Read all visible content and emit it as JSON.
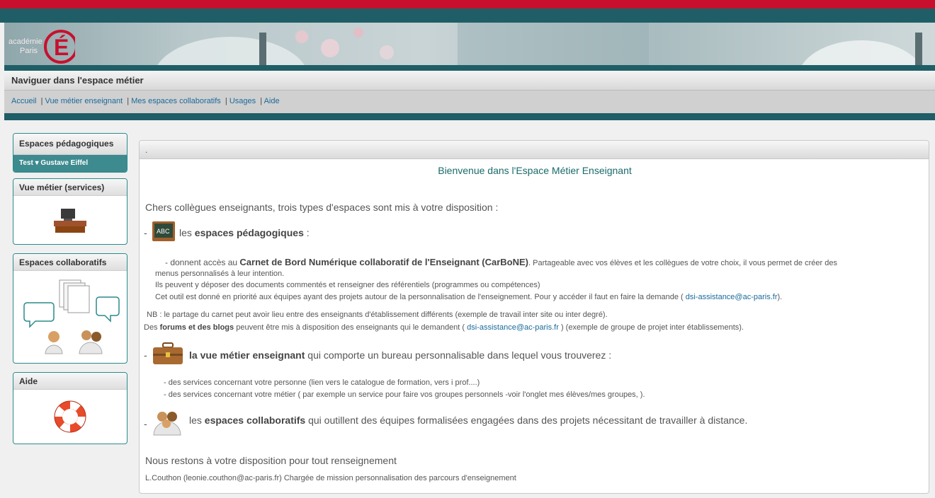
{
  "header": {
    "logo_line1": "académie",
    "logo_line2": "Paris",
    "logo_letter": "É"
  },
  "nav": {
    "title": "Naviguer dans l'espace métier",
    "links": [
      "Accueil",
      "Vue métier enseignant",
      "Mes espaces collaboratifs",
      "Usages",
      "Aide"
    ]
  },
  "sidebar": {
    "pedagogiques": {
      "title": "Espaces pédagogiques",
      "selector": "Test",
      "school": "Gustave Eiffel"
    },
    "vue_metier": {
      "title": "Vue métier (services)"
    },
    "collaboratifs": {
      "title": "Espaces collaboratifs"
    },
    "aide": {
      "title": "Aide"
    }
  },
  "main": {
    "header_text": ".",
    "welcome": "Bienvenue dans l'Espace Métier Enseignant",
    "intro": "Chers collègues enseignants, trois types d'espaces sont mis à votre disposition :",
    "sec1": {
      "dash": "-",
      "icon_text": "ABC",
      "pre": "les ",
      "bold": "espaces pédagogiques",
      "post": " :",
      "l1_pre": "- donnent accès au ",
      "l1_bold": "Carnet de Bord Numérique collaboratif de l'Enseignant (CarBoNE)",
      "l1_post": ". Partageable avec vos élèves et les collègues de votre choix, il vous permet de créer des",
      "l2": "menus personnalisés à leur intention.",
      "l3": "Ils peuvent y déposer des documents commentés et renseigner des référentiels (programmes ou compétences)",
      "l4_pre": "Cet outil est donné en priorité aux équipes ayant des projets autour de la personnalisation de l'enseignement. Pour y accéder il faut en faire la demande ( ",
      "l4_link": "dsi-assistance@ac-paris.fr",
      "l4_post": ").",
      "nb": "NB : le partage du carnet peut avoir lieu entre des enseignants d'établissement différents (exemple de travail inter site ou inter degré).",
      "forums_pre": "Des ",
      "forums_bold": "forums et des blogs",
      "forums_mid": " peuvent être mis à disposition des enseignants qui le demandent ( ",
      "forums_link": "dsi-assistance@ac-paris.fr",
      "forums_post": " ) (exemple de groupe de projet inter établissements)."
    },
    "sec2": {
      "dash": "-",
      "bold": "la vue métier enseignant",
      "post": " qui comporte un bureau personnalisable dans lequel vous trouverez :",
      "l1": "- des services concernant votre personne (lien vers le catalogue de formation, vers i prof....)",
      "l2": "- des services concernant votre métier ( par exemple un  service pour faire vos groupes personnels -voir l'onglet mes élèves/mes groupes, )."
    },
    "sec3": {
      "dash": "-",
      "pre": "les ",
      "bold": "espaces collaboratifs",
      "post": "  qui outillent des équipes formalisées engagées dans des projets nécessitant de travailler à distance."
    },
    "closing": "Nous restons à votre disposition pour tout renseignement",
    "signature": "L.Couthon (leonie.couthon@ac-paris.fr) Chargée de mission personnalisation des parcours d'enseignement"
  },
  "colors": {
    "accent": "#1f5e66",
    "brand_red": "#c8102e",
    "link": "#1a6a9a"
  }
}
